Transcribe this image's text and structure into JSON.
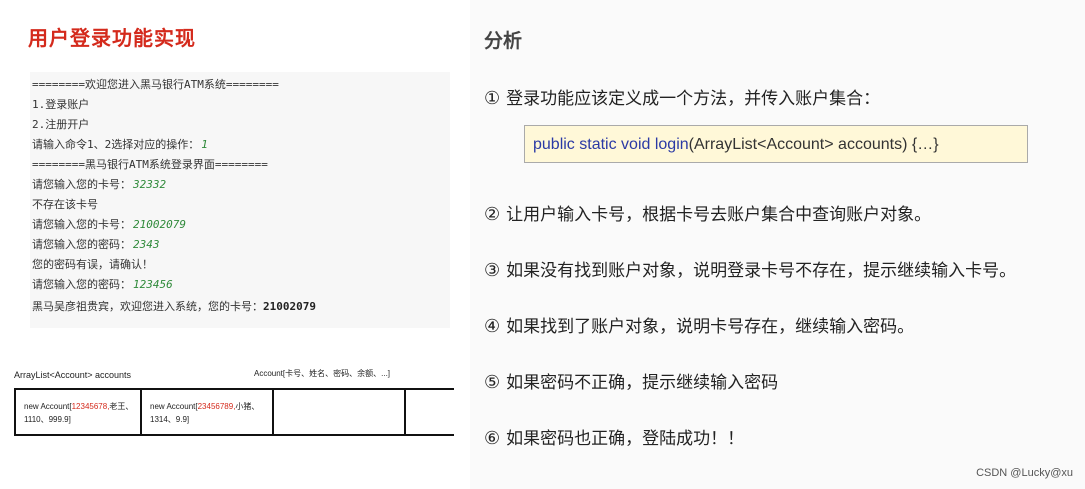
{
  "left": {
    "title": "用户登录功能实现",
    "console": [
      {
        "label": "========欢迎您进入黑马银行ATM系统========",
        "input": ""
      },
      {
        "label": "1.登录账户",
        "input": ""
      },
      {
        "label": "2.注册开户",
        "input": ""
      },
      {
        "label": "请输入命令1、2选择对应的操作：",
        "input": "1"
      },
      {
        "label": "========黑马银行ATM系统登录界面========",
        "input": ""
      },
      {
        "label": "请您输入您的卡号：",
        "input": "32332"
      },
      {
        "label": "不存在该卡号",
        "input": ""
      },
      {
        "label": "请您输入您的卡号：",
        "input": "21002079"
      },
      {
        "label": "请您输入您的密码：",
        "input": "2343"
      },
      {
        "label": "您的密码有误，请确认！",
        "input": ""
      },
      {
        "label": "请您输入您的密码：",
        "input": "123456"
      },
      {
        "label": "黑马吴彦祖贵宾，欢迎您进入系统，您的卡号：",
        "input": "",
        "bold": "21002079"
      }
    ],
    "diagram": {
      "left_label": "ArrayList<Account>  accounts",
      "right_label": "Account[卡号、姓名、密码、余额、...]",
      "cells": [
        {
          "prefix": "new Account[",
          "highlight": "12345678,",
          "suffix": "老王、1110、999.9]"
        },
        {
          "prefix": "new Account[",
          "highlight": "23456789,",
          "suffix": "小猪、1314、9.9]"
        }
      ]
    }
  },
  "right": {
    "title": "分析",
    "steps": [
      {
        "num": "①",
        "text": "登录功能应该定义成一个方法，并传入账户集合："
      },
      {
        "num": "②",
        "text": "让用户输入卡号，根据卡号去账户集合中查询账户对象。"
      },
      {
        "num": "③",
        "text": "如果没有找到账户对象，说明登录卡号不存在，提示继续输入卡号。"
      },
      {
        "num": "④",
        "text": "如果找到了账户对象，说明卡号存在，继续输入密码。"
      },
      {
        "num": "⑤",
        "text": "如果密码不正确，提示继续输入密码"
      },
      {
        "num": "⑥",
        "text": "如果密码也正确，登陆成功！！"
      }
    ],
    "code": {
      "keyword": "public static void login",
      "rest": "(ArrayList<Account> accounts) {…}"
    },
    "watermark": "CSDN @Lucky@xu"
  }
}
